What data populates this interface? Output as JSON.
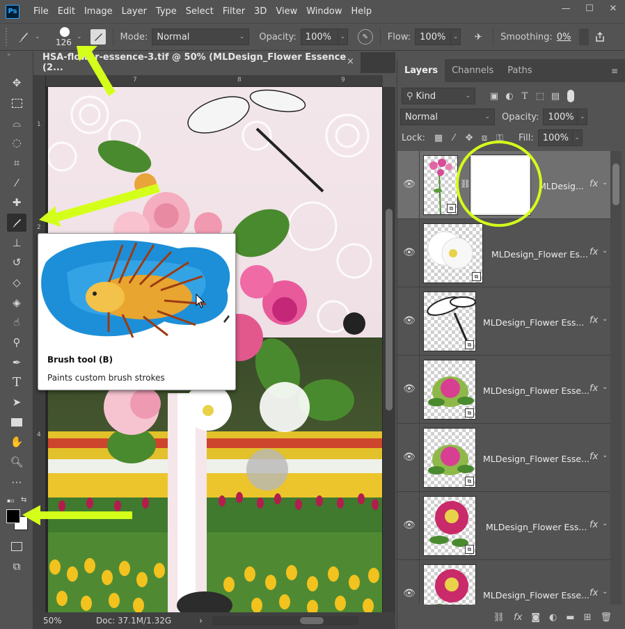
{
  "app": {
    "logo": "Ps"
  },
  "menu": [
    "File",
    "Edit",
    "Image",
    "Layer",
    "Type",
    "Select",
    "Filter",
    "3D",
    "View",
    "Window",
    "Help"
  ],
  "window_controls": {
    "minimize": "—",
    "maximize": "☐",
    "close": "✕"
  },
  "options_bar": {
    "brush_size": "126",
    "mode_label": "Mode:",
    "mode_value": "Normal",
    "opacity_label": "Opacity:",
    "opacity_value": "100%",
    "flow_label": "Flow:",
    "flow_value": "100%",
    "smoothing_label": "Smoothing:",
    "smoothing_value": "0%"
  },
  "document": {
    "tab_title": "HSA-flower-essence-3.tif @ 50% (MLDesign_Flower Essence (2...",
    "close": "×",
    "ruler_top_labels": [
      "7",
      "8",
      "9"
    ],
    "ruler_left_labels": [
      "1",
      "2",
      "3",
      "4"
    ],
    "zoom": "50%",
    "doc_info": "Doc: 37.1M/1.32G",
    "status_arrow": "›"
  },
  "tooltip": {
    "title": "Brush tool (B)",
    "description": "Paints custom brush strokes"
  },
  "layers_panel": {
    "tabs": [
      "Layers",
      "Channels",
      "Paths"
    ],
    "active_tab": "Layers",
    "filter_value": "Kind",
    "blend_mode": "Normal",
    "opacity_label": "Opacity:",
    "opacity_value": "100%",
    "lock_label": "Lock:",
    "fill_label": "Fill:",
    "fill_value": "100%",
    "layers": [
      {
        "name": "MLDesig...",
        "fx": "fx",
        "has_mask": true,
        "selected": true
      },
      {
        "name": "MLDesign_Flower Es...",
        "fx": "fx"
      },
      {
        "name": "MLDesign_Flower Ess...",
        "fx": "fx"
      },
      {
        "name": "MLDesign_Flower Esse...",
        "fx": "fx"
      },
      {
        "name": "MLDesign_Flower Esse...",
        "fx": "fx"
      },
      {
        "name": "MLDesign_Flower Ess...",
        "fx": "fx"
      },
      {
        "name": "MLDesign_Flower Esse...",
        "fx": "fx"
      }
    ]
  },
  "colors": {
    "ui_bg": "#535353",
    "accent_annotation": "#d4ff1a",
    "foreground": "#000000",
    "background": "#ffffff"
  }
}
